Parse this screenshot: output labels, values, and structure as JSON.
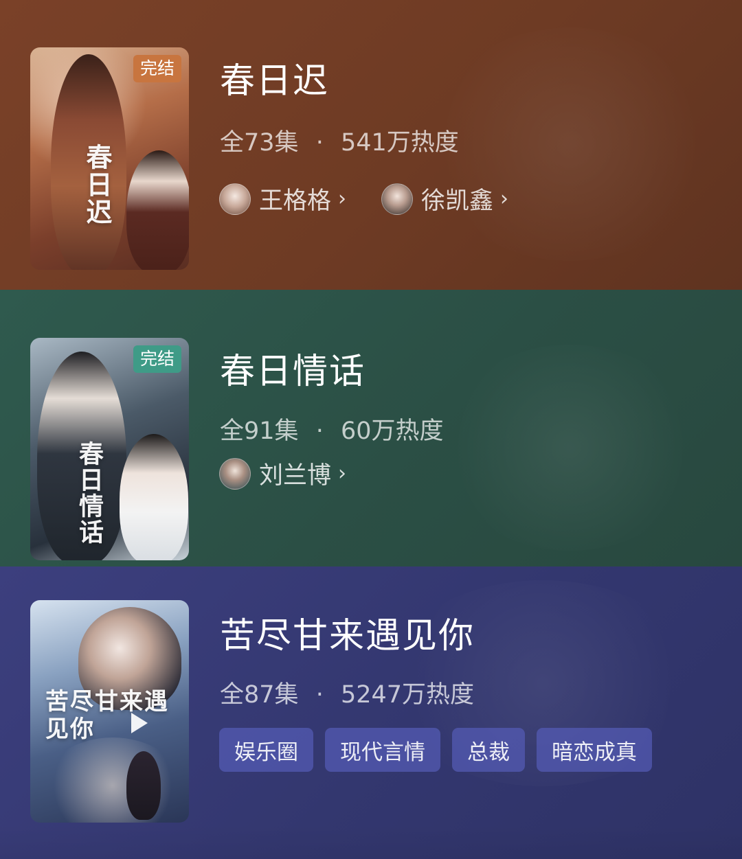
{
  "shows": [
    {
      "title": "春日迟",
      "badge": "完结",
      "episodes": "全73集",
      "separator": "·",
      "heat": "541万热度",
      "actors": [
        {
          "name": "王格格",
          "chevron": "›"
        },
        {
          "name": "徐凯鑫",
          "chevron": "›"
        }
      ],
      "poster_text": "春日迟",
      "bg_color": "#6e3b24",
      "badge_color": "#c8753f"
    },
    {
      "title": "春日情话",
      "badge": "完结",
      "episodes": "全91集",
      "separator": "·",
      "heat": "60万热度",
      "actors": [
        {
          "name": "刘兰博",
          "chevron": "›"
        }
      ],
      "poster_text": "春日情话",
      "bg_color": "#2b4f45",
      "badge_color": "#3f9b87"
    },
    {
      "title": "苦尽甘来遇见你",
      "episodes": "全87集",
      "separator": "·",
      "heat": "5247万热度",
      "tags": [
        "娱乐圈",
        "现代言情",
        "总裁",
        "暗恋成真"
      ],
      "poster_text": "苦尽甘来遇见你",
      "bg_color": "#33376f",
      "tag_color": "#545cb6"
    }
  ]
}
